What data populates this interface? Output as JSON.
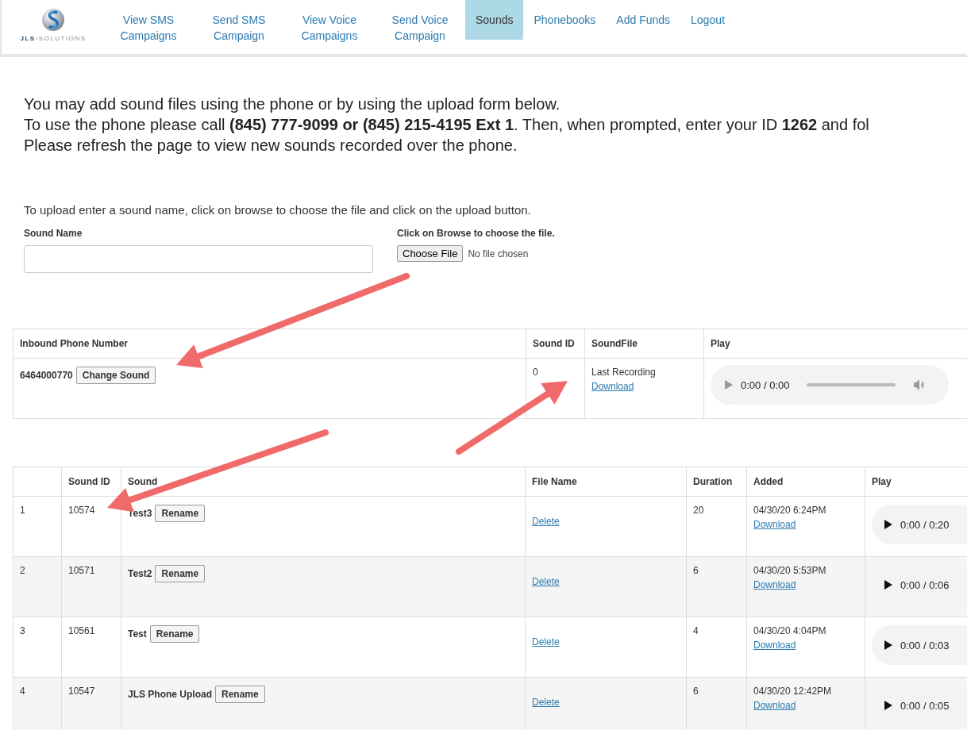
{
  "logo": {
    "wordmark": "**JLS**›SOLUTIONS"
  },
  "nav": [
    {
      "label": "View SMS Campaigns",
      "selected": false
    },
    {
      "label": "Send SMS Campaign",
      "selected": false
    },
    {
      "label": "View Voice Campaigns",
      "selected": false
    },
    {
      "label": "Send Voice Campaign",
      "selected": false
    },
    {
      "label": "Sounds",
      "selected": true
    },
    {
      "label": "Phonebooks",
      "selected": false
    },
    {
      "label": "Add Funds",
      "selected": false
    },
    {
      "label": "Logout",
      "selected": false
    }
  ],
  "intro": [
    "You may add sound files using the phone or by using the upload form below.",
    "To use the phone please call **(845) 777-9099 or (845) 215-4195 Ext 1**. Then, when prompted, enter your ID **1262** and fol",
    "Please refresh the page to view new sounds recorded over the phone."
  ],
  "upload": {
    "instructions": "To upload enter a sound name, click on browse to choose the file and click on the upload button.",
    "name_label": "Sound Name",
    "file_label": "Click on Browse to choose the file.",
    "file_button": "Choose File",
    "file_status": "No file chosen"
  },
  "inbound_table": {
    "columns": [
      "Inbound Phone Number",
      "Sound ID",
      "SoundFile",
      "Play"
    ],
    "rows": [
      {
        "phone": "6464000770",
        "button": "Change Sound",
        "sound_id": "0",
        "sound_file": "Last Recording",
        "link": "Download",
        "time": "0:00 / 0:00"
      }
    ]
  },
  "sounds_table": {
    "columns": [
      "",
      "Sound ID",
      "Sound",
      "File Name",
      "Duration",
      "Added",
      "Play"
    ],
    "rows": [
      {
        "index": "1",
        "sound_id": "10574",
        "sound": "Test3",
        "button": "Rename",
        "delete": "Delete",
        "duration": "20",
        "added": "04/30/20 6:24PM",
        "link": "Download",
        "time": "0:00 / 0:20"
      },
      {
        "index": "2",
        "sound_id": "10571",
        "sound": "Test2",
        "button": "Rename",
        "delete": "Delete",
        "duration": "6",
        "added": "04/30/20 5:53PM",
        "link": "Download",
        "time": "0:00 / 0:06"
      },
      {
        "index": "3",
        "sound_id": "10561",
        "sound": "Test",
        "button": "Rename",
        "delete": "Delete",
        "duration": "4",
        "added": "04/30/20 4:04PM",
        "link": "Download",
        "time": "0:00 / 0:03"
      },
      {
        "index": "4",
        "sound_id": "10547",
        "sound": "JLS Phone Upload",
        "button": "Rename",
        "delete": "Delete",
        "duration": "6",
        "added": "04/30/20 12:42PM",
        "link": "Download",
        "time": "0:00 / 0:05"
      }
    ]
  }
}
